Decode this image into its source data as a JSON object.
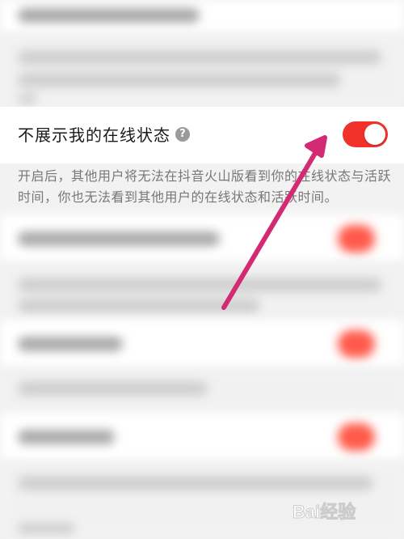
{
  "setting": {
    "title": "不展示我的在线状态",
    "help_glyph": "?",
    "toggle_on": true,
    "description": "开启后，其他用户将无法在抖音火山版看到你的在线状态与活跃时间，你也无法看到其他用户的在线状态和活跃时间。"
  },
  "colors": {
    "toggle": "#f0322a",
    "arrow": "#d42a74",
    "blurred_toggle": "#ff5a4a"
  },
  "watermark": {
    "text": "Bai经验"
  }
}
